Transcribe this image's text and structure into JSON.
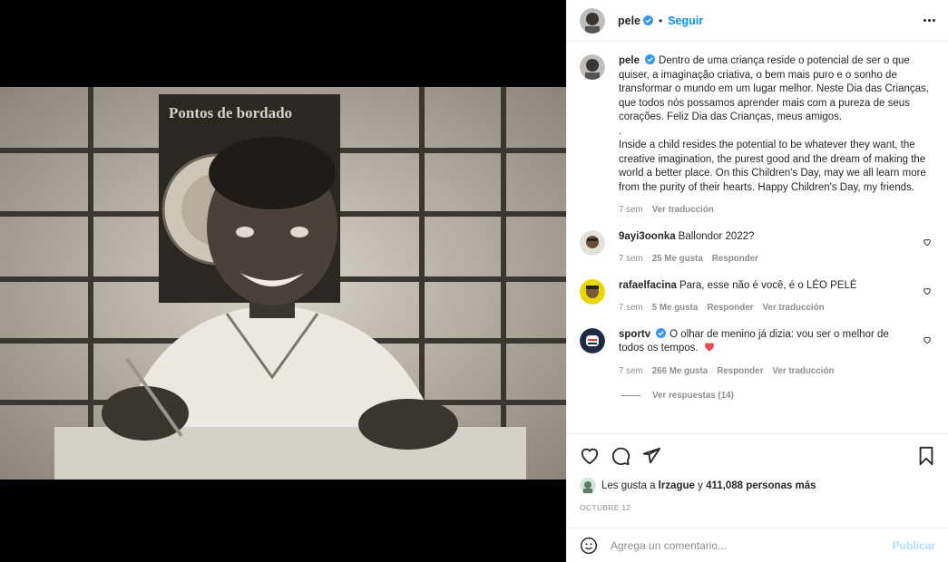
{
  "header": {
    "username": "pele",
    "separator": "•",
    "follow_label": "Seguir"
  },
  "caption": {
    "username": "pele",
    "text_pt": "Dentro de uma criança reside o potencial de ser o que quiser, a imaginação criativa, o bem mais puro e o sonho de transformar o mundo em um lugar melhor. Neste Dia das Crianças, que todos nós possamos aprender mais com a pureza de seus corações. Feliz Dia das Crianças, meus amigos.",
    "dot": ".",
    "text_en": "Inside a child resides the potential to be whatever they want, the creative imagination, the purest good and the dream of making the world a better place. On this Children's Day, may we all learn more from the purity of their hearts. Happy Children's Day, my friends.",
    "time": "7 sem",
    "translate": "Ver traducción"
  },
  "comments": [
    {
      "username": "9ayi3oonka",
      "text": "Ballondor 2022?",
      "time": "7 sem",
      "likes": "25 Me gusta",
      "reply": "Responder",
      "translate": ""
    },
    {
      "username": "rafaelfacina",
      "text": "Para, esse não é você, é o LÉO PELÉ",
      "time": "7 sem",
      "likes": "5 Me gusta",
      "reply": "Responder",
      "translate": "Ver traducción"
    },
    {
      "username": "sportv",
      "text": "O olhar de menino já dizia: vou ser o melhor de todos os tempos.",
      "time": "7 sem",
      "likes": "266 Me gusta",
      "reply": "Responder",
      "translate": "Ver traducción"
    }
  ],
  "view_replies": "Ver respuestas (14)",
  "likes": {
    "prefix": "Les gusta a",
    "user": "lrzague",
    "connector": "y",
    "others": "411,088 personas más"
  },
  "date": "OCTUBRE 12",
  "add_comment": {
    "placeholder": "Agrega un comentario...",
    "post_label": "Publicar"
  },
  "colors": {
    "accent": "#0095f6",
    "verified": "#3897f0",
    "muted": "#8e8e8e",
    "heart": "#ed4956",
    "sportv": "#1f2a44"
  },
  "photo": {
    "poster_text": "Pontos de bordado"
  }
}
